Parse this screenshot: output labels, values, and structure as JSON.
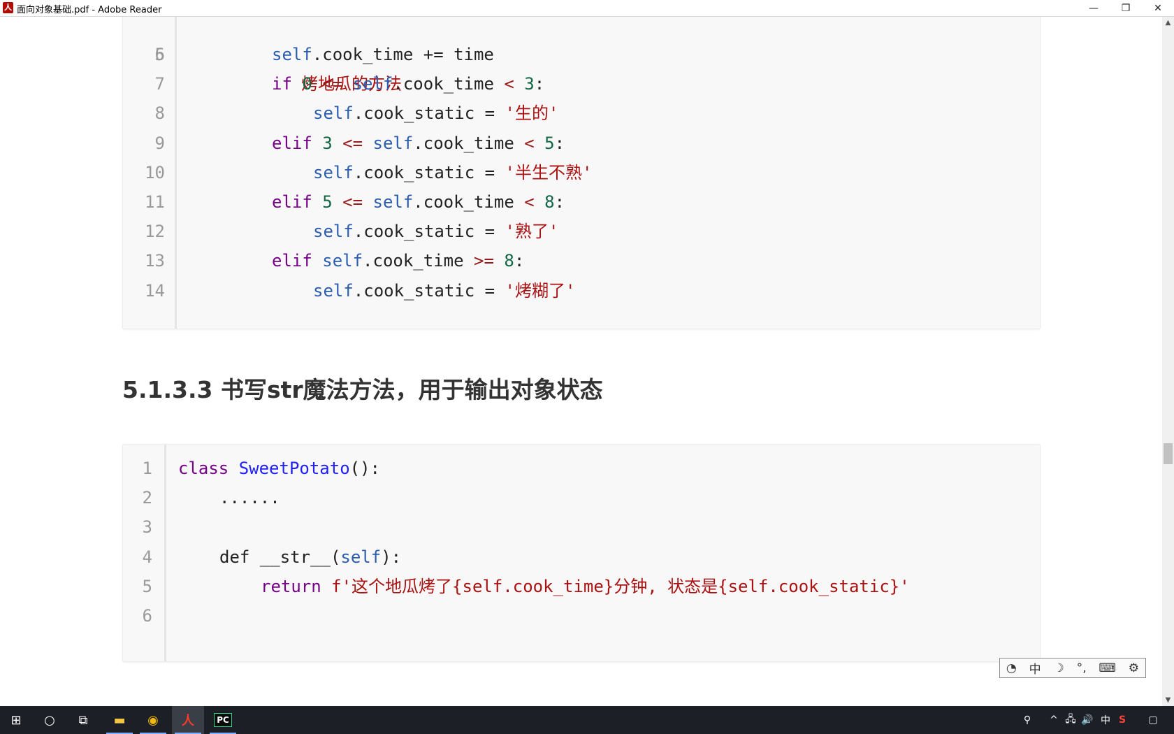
{
  "window": {
    "title": "面向对象基础.pdf - Adobe Reader",
    "app_icon_glyph": "人",
    "controls": {
      "minimize": "—",
      "restore": "❐",
      "close": "✕"
    }
  },
  "code_block_1": {
    "partial_top_line": {
      "num": "5",
      "text": "烤地瓜的方法"
    },
    "lines": [
      {
        "num": "6",
        "tokens": [
          {
            "t": "self",
            "c": "self"
          },
          {
            "t": ".cook_time += time",
            "c": "plain"
          }
        ]
      },
      {
        "num": "7",
        "tokens": [
          {
            "t": "if ",
            "c": "kw"
          },
          {
            "t": "0",
            "c": "num"
          },
          {
            "t": " <= ",
            "c": "op"
          },
          {
            "t": "self",
            "c": "self"
          },
          {
            "t": ".cook_time ",
            "c": "plain"
          },
          {
            "t": "<",
            "c": "op"
          },
          {
            "t": " 3",
            "c": "num"
          },
          {
            "t": ":",
            "c": "plain"
          }
        ]
      },
      {
        "num": "8",
        "tokens": [
          {
            "t": "self",
            "c": "self"
          },
          {
            "t": ".cook_static = ",
            "c": "plain"
          },
          {
            "t": "'生的'",
            "c": "str"
          }
        ]
      },
      {
        "num": "9",
        "tokens": [
          {
            "t": "elif ",
            "c": "kw"
          },
          {
            "t": "3",
            "c": "num"
          },
          {
            "t": " <= ",
            "c": "op"
          },
          {
            "t": "self",
            "c": "self"
          },
          {
            "t": ".cook_time ",
            "c": "plain"
          },
          {
            "t": "<",
            "c": "op"
          },
          {
            "t": " 5",
            "c": "num"
          },
          {
            "t": ":",
            "c": "plain"
          }
        ]
      },
      {
        "num": "10",
        "tokens": [
          {
            "t": "self",
            "c": "self"
          },
          {
            "t": ".cook_static = ",
            "c": "plain"
          },
          {
            "t": "'半生不熟'",
            "c": "str"
          }
        ]
      },
      {
        "num": "11",
        "tokens": [
          {
            "t": "elif ",
            "c": "kw"
          },
          {
            "t": "5",
            "c": "num"
          },
          {
            "t": " <= ",
            "c": "op"
          },
          {
            "t": "self",
            "c": "self"
          },
          {
            "t": ".cook_time ",
            "c": "plain"
          },
          {
            "t": "<",
            "c": "op"
          },
          {
            "t": " 8",
            "c": "num"
          },
          {
            "t": ":",
            "c": "plain"
          }
        ]
      },
      {
        "num": "12",
        "tokens": [
          {
            "t": "self",
            "c": "self"
          },
          {
            "t": ".cook_static = ",
            "c": "plain"
          },
          {
            "t": "'熟了'",
            "c": "str"
          }
        ]
      },
      {
        "num": "13",
        "tokens": [
          {
            "t": "elif ",
            "c": "kw"
          },
          {
            "t": "self",
            "c": "self"
          },
          {
            "t": ".cook_time ",
            "c": "plain"
          },
          {
            "t": ">=",
            "c": "op"
          },
          {
            "t": " 8",
            "c": "num"
          },
          {
            "t": ":",
            "c": "plain"
          }
        ]
      },
      {
        "num": "14",
        "tokens": [
          {
            "t": "self",
            "c": "self"
          },
          {
            "t": ".cook_static = ",
            "c": "plain"
          },
          {
            "t": "'烤糊了'",
            "c": "str"
          }
        ]
      }
    ]
  },
  "section_heading": "5.1.3.3 书写str魔法方法，用于输出对象状态",
  "code_block_2": {
    "lines": [
      {
        "num": "1",
        "tokens": [
          {
            "t": "class ",
            "c": "kw"
          },
          {
            "t": "SweetPotato",
            "c": "cls"
          },
          {
            "t": "():",
            "c": "plain"
          }
        ]
      },
      {
        "num": "2",
        "tokens": [
          {
            "t": "......",
            "c": "plain"
          }
        ]
      },
      {
        "num": "3",
        "tokens": []
      },
      {
        "num": "4",
        "tokens": [
          {
            "t": "def ",
            "c": "plain"
          },
          {
            "t": "__str__(",
            "c": "plain"
          },
          {
            "t": "self",
            "c": "self"
          },
          {
            "t": "):",
            "c": "plain"
          }
        ]
      },
      {
        "num": "5",
        "tokens": [
          {
            "t": "return ",
            "c": "kw"
          },
          {
            "t": "f'这个地瓜烤了{self.cook_time}分钟, 状态是{self.cook_static}'",
            "c": "str"
          }
        ]
      },
      {
        "num": "6",
        "tokens": []
      }
    ]
  },
  "ime_toolbar": {
    "items": [
      "◔",
      "中",
      "☽",
      "°,",
      "⌨",
      "⚙"
    ]
  },
  "scrollbar": {
    "up": "▲",
    "down": "▼"
  },
  "taskbar": {
    "apps": [
      {
        "name": "start-button",
        "glyph": "⊞"
      },
      {
        "name": "search-button",
        "glyph": "○"
      },
      {
        "name": "task-view-button",
        "glyph": "⧉"
      },
      {
        "name": "file-explorer-button",
        "glyph": "▬"
      },
      {
        "name": "chrome-button",
        "glyph": "◉"
      },
      {
        "name": "adobe-reader-button",
        "glyph": "人"
      },
      {
        "name": "pycharm-button",
        "glyph": "PC"
      }
    ],
    "tray": [
      {
        "name": "people-icon",
        "glyph": "⚲"
      },
      {
        "name": "tray-expand-icon",
        "glyph": "^"
      },
      {
        "name": "network-icon",
        "glyph": "🖧"
      },
      {
        "name": "volume-icon",
        "glyph": "🔊"
      },
      {
        "name": "ime-indicator",
        "glyph": "中"
      },
      {
        "name": "sogou-icon",
        "glyph": "S"
      },
      {
        "name": "notification-icon",
        "glyph": "▢"
      }
    ]
  }
}
